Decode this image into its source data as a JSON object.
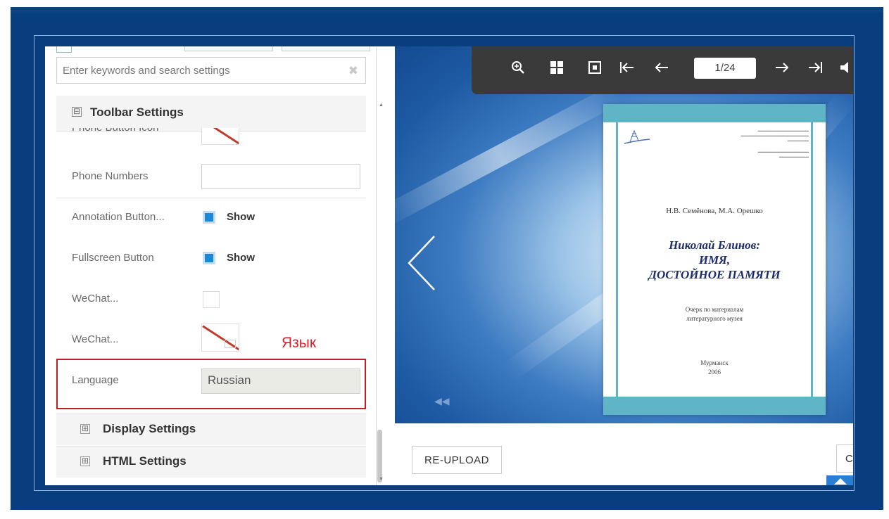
{
  "sidebar": {
    "search_placeholder": "Enter keywords and search settings",
    "clear_icon": "✖",
    "toolbar_section": {
      "label": "Toolbar Settings",
      "icon": "⊟"
    },
    "partial_row_label": "Phone Button Icon",
    "rows": {
      "phone_numbers": {
        "label": "Phone Numbers",
        "value": ""
      },
      "annotation_button": {
        "label": "Annotation Button...",
        "checked": true,
        "option": "Show"
      },
      "fullscreen_button": {
        "label": "Fullscreen Button",
        "checked": true,
        "option": "Show"
      },
      "wechat_1": {
        "label": "WeChat...",
        "checked": false
      },
      "wechat_2": {
        "label": "WeChat..."
      },
      "language": {
        "label": "Language",
        "value": "Russian"
      }
    },
    "annotation_text": "Язык",
    "collapsed_sections": [
      {
        "label": "Display Settings",
        "icon": "⊞"
      },
      {
        "label": "HTML Settings",
        "icon": "⊞"
      }
    ]
  },
  "viewer": {
    "page_indicator": "1/24",
    "toolbar_icons": [
      "zoom-in-icon",
      "thumbnails-icon",
      "fit-page-icon",
      "first-page-icon",
      "prev-page-icon",
      "next-page-icon",
      "last-page-icon",
      "sound-icon"
    ],
    "book": {
      "authors": "Н.В. Семёнова,  М.А. Орешко",
      "title_lines": [
        "Николай Блинов:",
        "ИМЯ,",
        "ДОСТОЙНОЕ ПАМЯТИ"
      ],
      "subtitle_lines": [
        "Очерк по материалам",
        "литературного музея"
      ],
      "city": "Мурманск",
      "year": "2006",
      "colors": {
        "band": "#5fb4c6",
        "title": "#1c2c6b"
      }
    }
  },
  "footer": {
    "reupload_label": "RE-UPLOAD",
    "cancel_label": "Cancel"
  },
  "colors": {
    "background": "#083e7d",
    "accent": "#1e88d8",
    "highlight": "#c41c24"
  }
}
